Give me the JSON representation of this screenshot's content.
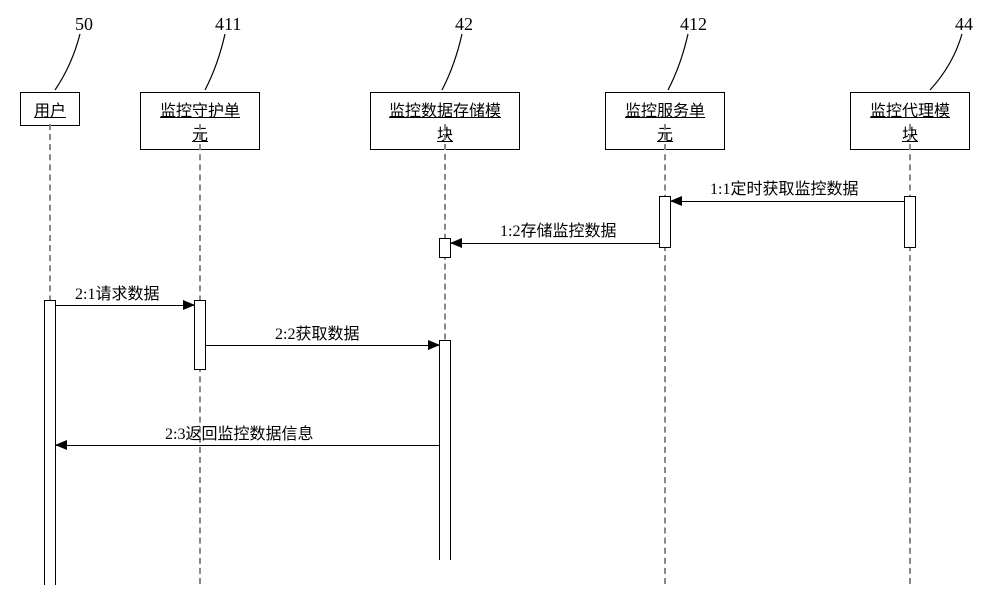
{
  "chart_data": {
    "type": "sequence-diagram",
    "participants": [
      {
        "id": "user",
        "label": "用户",
        "ref": "50"
      },
      {
        "id": "daemon",
        "label": "监控守护单元",
        "ref": "411"
      },
      {
        "id": "storage",
        "label": "监控数据存储模块",
        "ref": "42"
      },
      {
        "id": "service",
        "label": "监控服务单元",
        "ref": "412"
      },
      {
        "id": "agent",
        "label": "监控代理模块",
        "ref": "44"
      }
    ],
    "messages": [
      {
        "from": "agent",
        "to": "service",
        "label": "1:1定时获取监控数据",
        "direction": "left"
      },
      {
        "from": "service",
        "to": "storage",
        "label": "1:2存储监控数据",
        "direction": "left"
      },
      {
        "from": "user",
        "to": "daemon",
        "label": "2:1请求数据",
        "direction": "right"
      },
      {
        "from": "daemon",
        "to": "storage",
        "label": "2:2获取数据",
        "direction": "right"
      },
      {
        "from": "storage",
        "to": "user",
        "label": "2:3返回监控数据信息",
        "direction": "left"
      }
    ]
  },
  "refs": {
    "user": "50",
    "daemon": "411",
    "storage": "42",
    "service": "412",
    "agent": "44"
  },
  "labels": {
    "user": "用户",
    "daemon": "监控守护单元",
    "storage": "监控数据存储模块",
    "service": "监控服务单元",
    "agent": "监控代理模块"
  },
  "messages": {
    "m11": "1:1定时获取监控数据",
    "m12": "1:2存储监控数据",
    "m21": "2:1请求数据",
    "m22": "2:2获取数据",
    "m23": "2:3返回监控数据信息"
  }
}
